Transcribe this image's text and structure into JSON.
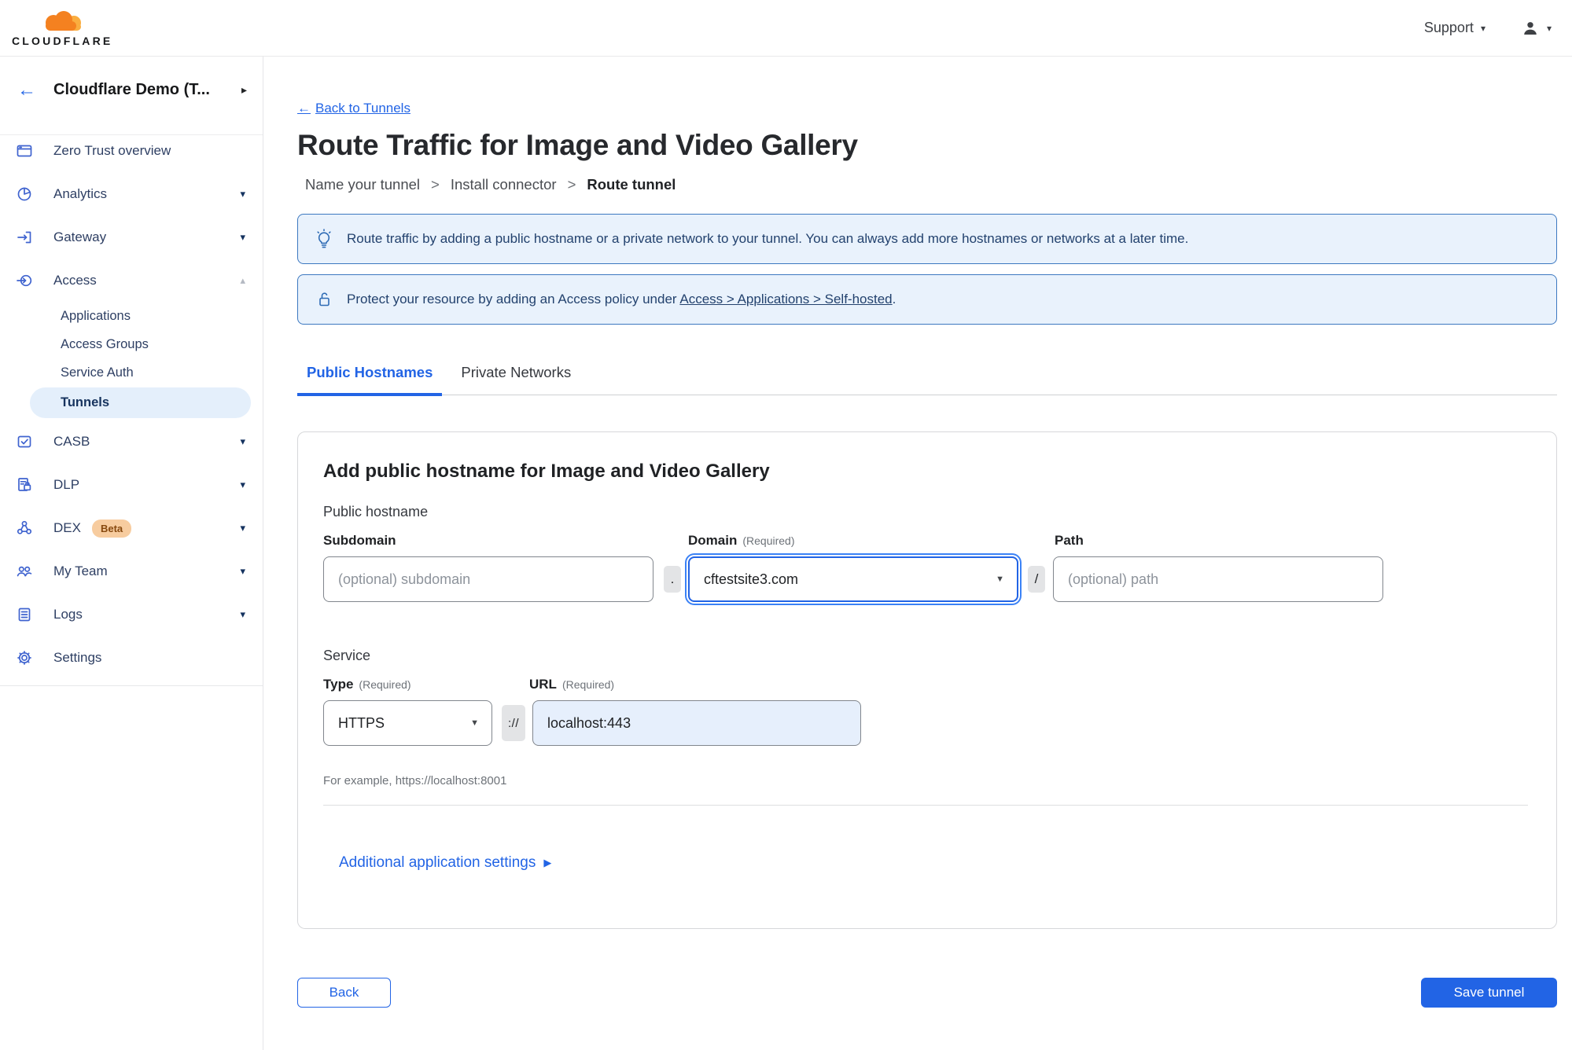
{
  "brand": {
    "name": "CLOUDFLARE"
  },
  "topbar": {
    "support": "Support"
  },
  "icons": {
    "back_arrow": "←",
    "chevron_right": "▸",
    "caret_down": "▾",
    "caret_up": "▴",
    "select_caret": "▼",
    "play_right": "▶",
    "step_separator": ">"
  },
  "sidebar": {
    "account": "Cloudflare Demo (T...",
    "items": [
      {
        "label": "Zero Trust overview"
      },
      {
        "label": "Analytics"
      },
      {
        "label": "Gateway"
      },
      {
        "label": "Access"
      },
      {
        "label": "CASB"
      },
      {
        "label": "DLP"
      },
      {
        "label": "DEX",
        "badge": "Beta"
      },
      {
        "label": "My Team"
      },
      {
        "label": "Logs"
      },
      {
        "label": "Settings"
      }
    ],
    "access_children": [
      {
        "label": "Applications"
      },
      {
        "label": "Access Groups"
      },
      {
        "label": "Service Auth"
      },
      {
        "label": "Tunnels"
      }
    ]
  },
  "page": {
    "back_link": "Back to Tunnels",
    "title": "Route Traffic for Image and Video Gallery",
    "steps": [
      "Name your tunnel",
      "Install connector",
      "Route tunnel"
    ],
    "banners": {
      "route_tip": "Route traffic by adding a public hostname or a private network to your tunnel. You can always add more hostnames or networks at a later time.",
      "protect_prefix": "Protect your resource by adding an Access policy under ",
      "protect_link": "Access > Applications > Self-hosted",
      "protect_suffix": "."
    },
    "tabs": [
      {
        "label": "Public Hostnames"
      },
      {
        "label": "Private Networks"
      }
    ]
  },
  "form": {
    "heading": "Add public hostname for Image and Video Gallery",
    "public_hostname_label": "Public hostname",
    "subdomain": {
      "label": "Subdomain",
      "placeholder": "(optional) subdomain"
    },
    "domain": {
      "label": "Domain",
      "required": "(Required)",
      "value": "cftestsite3.com"
    },
    "path": {
      "label": "Path",
      "placeholder": "(optional) path"
    },
    "separators": {
      "dot": ".",
      "slash": "/",
      "scheme": "://"
    },
    "service_label": "Service",
    "type": {
      "label": "Type",
      "required": "(Required)",
      "value": "HTTPS"
    },
    "url": {
      "label": "URL",
      "required": "(Required)",
      "value": "localhost:443"
    },
    "example": "For example, https://localhost:8001",
    "additional_settings": "Additional application settings"
  },
  "footer": {
    "back": "Back",
    "save": "Save tunnel"
  },
  "colors": {
    "accent": "#2264e5",
    "banner_bg": "#e9f2fc",
    "banner_border": "#3c78c0",
    "url_field_bg": "#e6effc",
    "beta_bg": "#f7cc9f",
    "beta_text": "#87490f",
    "sidebar_icon": "#3f63cf",
    "active_pill_bg": "#e4effb"
  }
}
